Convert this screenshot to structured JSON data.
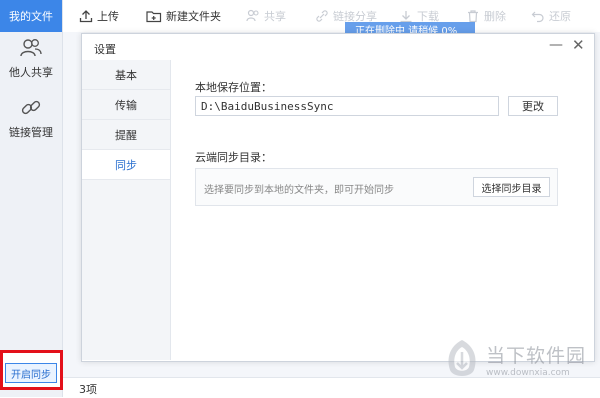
{
  "sidebar": {
    "my_files": "我的文件",
    "share": "他人共享",
    "link_manage": "链接管理",
    "sync_button": "开启同步"
  },
  "toolbar": {
    "upload": "上传",
    "new_folder": "新建文件夹",
    "share": "共享",
    "link_share": "链接分享",
    "download": "下载",
    "delete": "删除",
    "restore": "还原",
    "progress_text": "正在删除中  请稍候  0%"
  },
  "dialog": {
    "title": "设置",
    "nav": [
      "基本",
      "传输",
      "提醒",
      "同步"
    ],
    "active_nav": "同步",
    "local_path_label": "本地保存位置：",
    "local_path_value": "D:\\BaiduBusinessSync",
    "change_button": "更改",
    "cloud_dir_label": "云端同步目录：",
    "cloud_hint": "选择要同步到本地的文件夹，即可开始同步",
    "select_button": "选择同步目录"
  },
  "status": {
    "count": "3项"
  },
  "watermark": {
    "name": "当下软件园",
    "url": "www.downxia.com"
  },
  "colors": {
    "accent": "#3c86e8",
    "highlight_frame": "#e3101a"
  }
}
